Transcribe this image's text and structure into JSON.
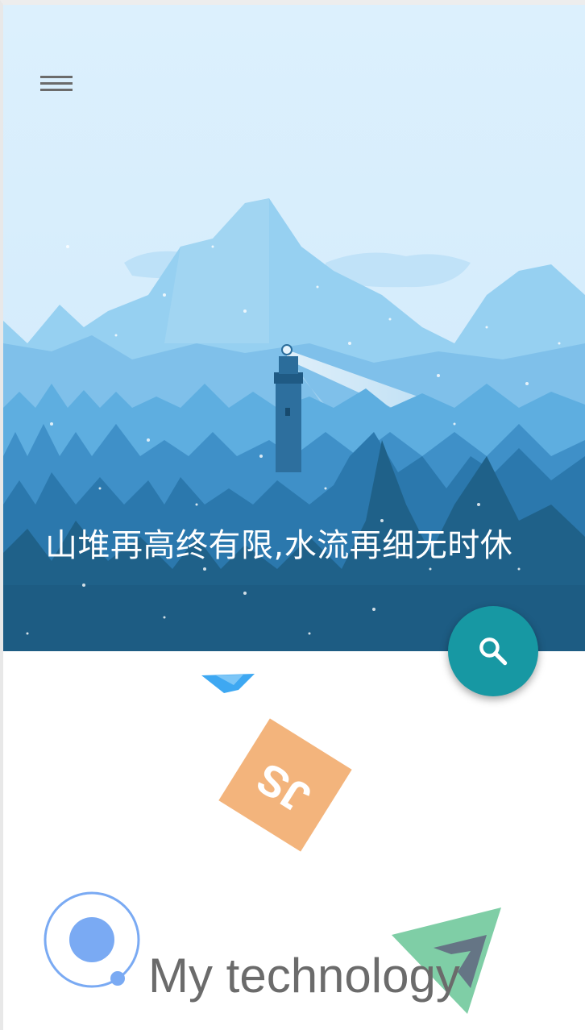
{
  "hero": {
    "title": "山堆再高终有限,水流再细无时休",
    "image": "lighthouse-mountain-forest-illustration"
  },
  "header": {
    "menu_icon": "hamburger-menu-icon"
  },
  "fab": {
    "icon": "search-icon",
    "color": "#1798a3"
  },
  "technology": {
    "title": "My technology",
    "logos": [
      {
        "name": "js-logo",
        "label": "JS",
        "color": "#f3b47c"
      },
      {
        "name": "ionic-logo",
        "color": "#7aaaf3"
      },
      {
        "name": "vue-logo",
        "color": "#7fcea6"
      },
      {
        "name": "blue-chevron-logo",
        "color": "#3ea8f2"
      }
    ]
  },
  "colors": {
    "sky": "#dbeefc",
    "mountain_far": "#8fcbf0",
    "forest_dark": "#1f6189"
  }
}
